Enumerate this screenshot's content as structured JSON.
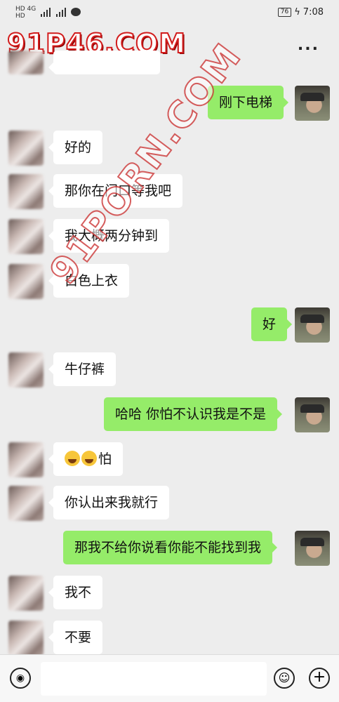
{
  "status_bar": {
    "network_left": "HD 4G",
    "battery": "76",
    "time": "7:08"
  },
  "header": {
    "watermark": "91P46.COM",
    "more_icon": "more-dots-icon",
    "more_label": "..."
  },
  "watermark_diagonal": "91PORN.COM",
  "messages": [
    {
      "side": "left",
      "text": ""
    },
    {
      "side": "right",
      "text": "刚下电梯"
    },
    {
      "side": "left",
      "text": "好的"
    },
    {
      "side": "left",
      "text": "那你在门口等我吧"
    },
    {
      "side": "left",
      "text": "我大概两分钟到"
    },
    {
      "side": "left",
      "text": "白色上衣"
    },
    {
      "side": "right",
      "text": "好"
    },
    {
      "side": "left",
      "text": "牛仔裤"
    },
    {
      "side": "right",
      "text": "哈哈 你怕不认识我是不是"
    },
    {
      "side": "left",
      "text": "怕",
      "emoji": "tears-of-joy-emoji x2"
    },
    {
      "side": "left",
      "text": "你认出来我就行"
    },
    {
      "side": "right",
      "text": "那我不给你说看你能不能找到我"
    },
    {
      "side": "left",
      "text": "我不"
    },
    {
      "side": "left",
      "text": "不要"
    }
  ],
  "input_bar": {
    "voice_icon": "voice-icon",
    "emoji_icon": "smiley-icon",
    "add_icon": "plus-icon",
    "placeholder": ""
  },
  "colors": {
    "background": "#ededed",
    "bubble_right": "#95ec69",
    "bubble_left": "#ffffff",
    "watermark_red": "#d21c1c"
  }
}
